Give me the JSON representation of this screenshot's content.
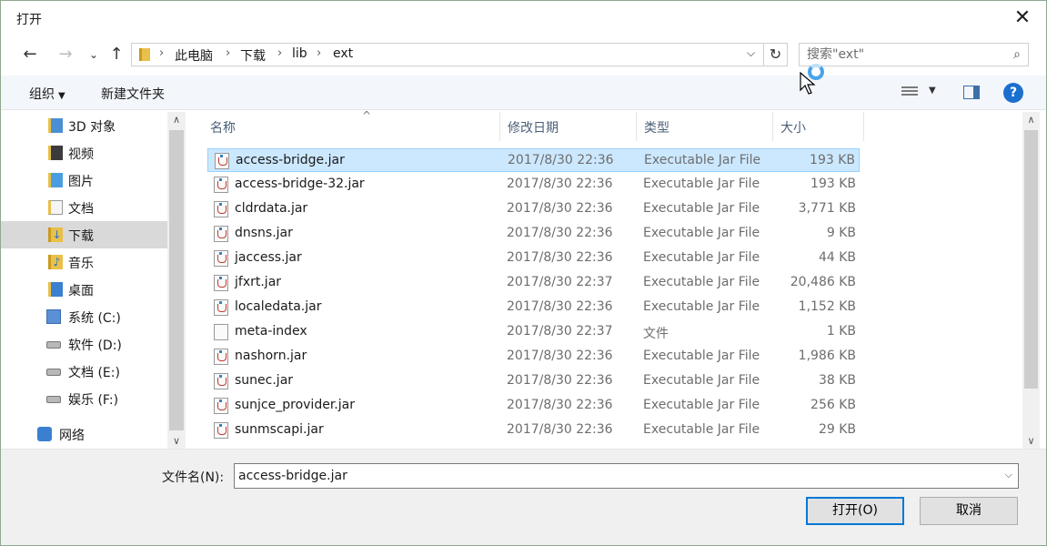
{
  "window": {
    "title": "打开"
  },
  "nav": {
    "breadcrumbs": [
      "此电脑",
      "下载",
      "lib",
      "ext"
    ],
    "search_placeholder": "搜索\"ext\""
  },
  "toolbar": {
    "organize": "组织",
    "new_folder": "新建文件夹",
    "help": "?"
  },
  "sidebar": {
    "items": [
      {
        "label": "3D 对象",
        "icon": "3d-objects-icon"
      },
      {
        "label": "视频",
        "icon": "video-folder-icon"
      },
      {
        "label": "图片",
        "icon": "pictures-folder-icon"
      },
      {
        "label": "文档",
        "icon": "documents-folder-icon"
      },
      {
        "label": "下载",
        "icon": "downloads-folder-icon",
        "selected": true
      },
      {
        "label": "音乐",
        "icon": "music-folder-icon"
      },
      {
        "label": "桌面",
        "icon": "desktop-folder-icon"
      },
      {
        "label": "系统 (C:)",
        "icon": "system-drive-icon"
      },
      {
        "label": "软件 (D:)",
        "icon": "drive-icon"
      },
      {
        "label": "文档 (E:)",
        "icon": "drive-icon"
      },
      {
        "label": "娱乐 (F:)",
        "icon": "drive-icon"
      },
      {
        "label": "网络",
        "icon": "network-icon"
      }
    ]
  },
  "columns": {
    "name": "名称",
    "date": "修改日期",
    "type": "类型",
    "size": "大小"
  },
  "files": [
    {
      "name": "access-bridge.jar",
      "date": "2017/8/30 22:36",
      "type": "Executable Jar File",
      "size": "193 KB",
      "icon": "jar-file-icon",
      "selected": true
    },
    {
      "name": "access-bridge-32.jar",
      "date": "2017/8/30 22:36",
      "type": "Executable Jar File",
      "size": "193 KB",
      "icon": "jar-file-icon"
    },
    {
      "name": "cldrdata.jar",
      "date": "2017/8/30 22:36",
      "type": "Executable Jar File",
      "size": "3,771 KB",
      "icon": "jar-file-icon"
    },
    {
      "name": "dnsns.jar",
      "date": "2017/8/30 22:36",
      "type": "Executable Jar File",
      "size": "9 KB",
      "icon": "jar-file-icon"
    },
    {
      "name": "jaccess.jar",
      "date": "2017/8/30 22:36",
      "type": "Executable Jar File",
      "size": "44 KB",
      "icon": "jar-file-icon"
    },
    {
      "name": "jfxrt.jar",
      "date": "2017/8/30 22:37",
      "type": "Executable Jar File",
      "size": "20,486 KB",
      "icon": "jar-file-icon"
    },
    {
      "name": "localedata.jar",
      "date": "2017/8/30 22:36",
      "type": "Executable Jar File",
      "size": "1,152 KB",
      "icon": "jar-file-icon"
    },
    {
      "name": "meta-index",
      "date": "2017/8/30 22:37",
      "type": "文件",
      "size": "1 KB",
      "icon": "generic-file-icon"
    },
    {
      "name": "nashorn.jar",
      "date": "2017/8/30 22:36",
      "type": "Executable Jar File",
      "size": "1,986 KB",
      "icon": "jar-file-icon"
    },
    {
      "name": "sunec.jar",
      "date": "2017/8/30 22:36",
      "type": "Executable Jar File",
      "size": "38 KB",
      "icon": "jar-file-icon"
    },
    {
      "name": "sunjce_provider.jar",
      "date": "2017/8/30 22:36",
      "type": "Executable Jar File",
      "size": "256 KB",
      "icon": "jar-file-icon"
    },
    {
      "name": "sunmscapi.jar",
      "date": "2017/8/30 22:36",
      "type": "Executable Jar File",
      "size": "29 KB",
      "icon": "jar-file-icon"
    }
  ],
  "footer": {
    "filename_label": "文件名(N):",
    "filename_value": "access-bridge.jar",
    "open_label": "打开(O)",
    "cancel_label": "取消"
  },
  "colors": {
    "accent": "#0078d7",
    "selection": "#cce8ff",
    "help": "#1b6fce"
  }
}
